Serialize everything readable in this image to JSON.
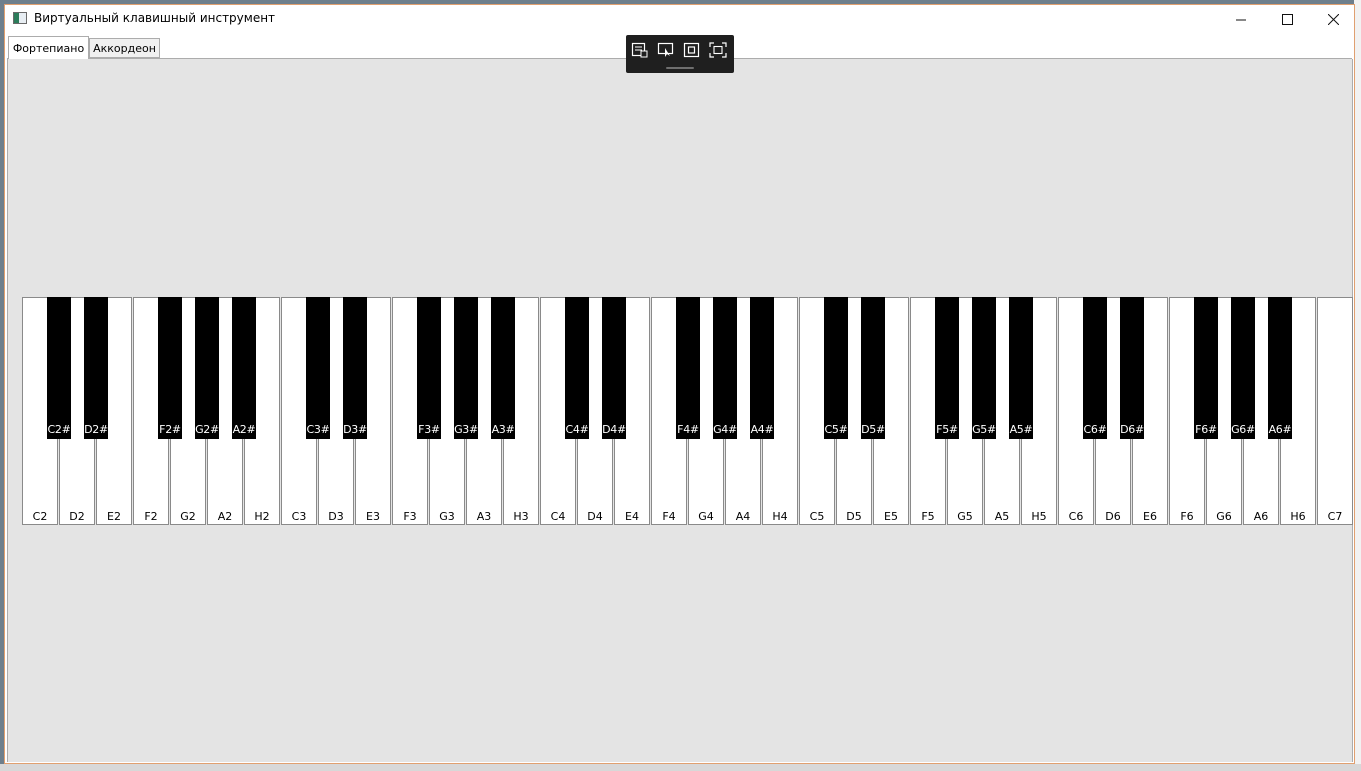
{
  "window": {
    "title": "Виртуальный клавишный инструмент"
  },
  "tabs": [
    {
      "label": "Фортепиано",
      "active": true
    },
    {
      "label": "Аккордеон",
      "active": false
    }
  ],
  "overlay_toolbar": {
    "buttons": [
      "window-select-icon",
      "pointer-select-icon",
      "rectangle-capture-icon",
      "fullscreen-capture-icon"
    ]
  },
  "piano": {
    "white_keys": [
      "C2",
      "D2",
      "E2",
      "F2",
      "G2",
      "A2",
      "H2",
      "C3",
      "D3",
      "E3",
      "F3",
      "G3",
      "A3",
      "H3",
      "C4",
      "D4",
      "E4",
      "F4",
      "G4",
      "A4",
      "H4",
      "C5",
      "D5",
      "E5",
      "F5",
      "G5",
      "A5",
      "H5",
      "C6",
      "D6",
      "E6",
      "F6",
      "G6",
      "A6",
      "H6",
      "C7"
    ],
    "black_keys": [
      {
        "label": "C2#",
        "after_white": 0
      },
      {
        "label": "D2#",
        "after_white": 1
      },
      {
        "label": "F2#",
        "after_white": 3
      },
      {
        "label": "G2#",
        "after_white": 4
      },
      {
        "label": "A2#",
        "after_white": 5
      },
      {
        "label": "C3#",
        "after_white": 7
      },
      {
        "label": "D3#",
        "after_white": 8
      },
      {
        "label": "F3#",
        "after_white": 10
      },
      {
        "label": "G3#",
        "after_white": 11
      },
      {
        "label": "A3#",
        "after_white": 12
      },
      {
        "label": "C4#",
        "after_white": 14
      },
      {
        "label": "D4#",
        "after_white": 15
      },
      {
        "label": "F4#",
        "after_white": 17
      },
      {
        "label": "G4#",
        "after_white": 18
      },
      {
        "label": "A4#",
        "after_white": 19
      },
      {
        "label": "C5#",
        "after_white": 21
      },
      {
        "label": "D5#",
        "after_white": 22
      },
      {
        "label": "F5#",
        "after_white": 24
      },
      {
        "label": "G5#",
        "after_white": 25
      },
      {
        "label": "A5#",
        "after_white": 26
      },
      {
        "label": "C6#",
        "after_white": 28
      },
      {
        "label": "D6#",
        "after_white": 29
      },
      {
        "label": "F6#",
        "after_white": 31
      },
      {
        "label": "G6#",
        "after_white": 32
      },
      {
        "label": "A6#",
        "after_white": 33
      }
    ]
  },
  "colors": {
    "window_border": "#e0a070",
    "content_bg": "#e4e4e4",
    "white_key": "#ffffff",
    "black_key": "#000000"
  }
}
